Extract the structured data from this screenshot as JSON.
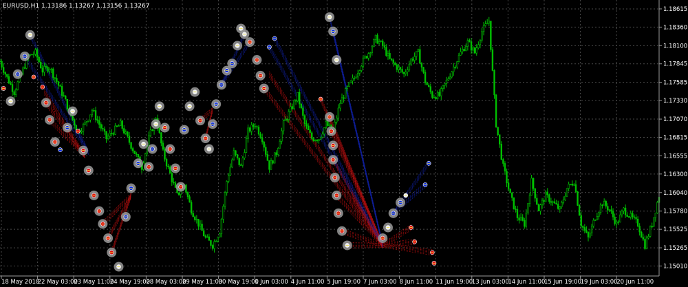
{
  "chart_data": {
    "type": "candlestick",
    "title": "EURUSD,H1  1.13186 1.13267 1.13156 1.13267",
    "grid": true,
    "background": "#000000",
    "colors": {
      "bull": "#00c000",
      "bear": "#00c000",
      "grid": "#4a4a4a",
      "axis": "#9a9a9a",
      "text": "#ffffff",
      "marker_ring": "#9a9a9a",
      "marker_white": "#f0f0f0",
      "marker_red": "#e01010",
      "marker_blue": "#1030e0",
      "marker_yellow": "#f0e040",
      "link_red": "#c01010",
      "link_blue": "#1020a0"
    },
    "ylim": [
      1.1487,
      1.1874
    ],
    "y_ticks": [
      "1.18615",
      "1.18360",
      "1.18100",
      "1.17845",
      "1.17585",
      "1.17330",
      "1.17070",
      "1.16815",
      "1.16555",
      "1.16300",
      "1.16040",
      "1.15780",
      "1.15525",
      "1.15265",
      "1.15010"
    ],
    "x_ticks": [
      "18 May 2018",
      "22 May 03:00",
      "23 May 11:00",
      "24 May 19:00",
      "28 May 03:00",
      "29 May 11:00",
      "30 May 19:00",
      "1 Jun 03:00",
      "4 Jun 11:00",
      "5 Jun 19:00",
      "7 Jun 03:00",
      "8 Jun 11:00",
      "11 Jun 19:00",
      "13 Jun 03:00",
      "14 Jun 11:00",
      "15 Jun 19:00",
      "19 Jun 03:00",
      "20 Jun 11:00"
    ],
    "path": [
      [
        0,
        1.1788
      ],
      [
        4,
        1.1765
      ],
      [
        8,
        1.1745
      ],
      [
        12,
        1.177
      ],
      [
        16,
        1.1795
      ],
      [
        20,
        1.18
      ],
      [
        24,
        1.1775
      ],
      [
        28,
        1.178
      ],
      [
        32,
        1.176
      ],
      [
        36,
        1.1738
      ],
      [
        40,
        1.1712
      ],
      [
        44,
        1.169
      ],
      [
        48,
        1.17
      ],
      [
        52,
        1.172
      ],
      [
        56,
        1.17
      ],
      [
        60,
        1.168
      ],
      [
        64,
        1.169
      ],
      [
        68,
        1.17
      ],
      [
        72,
        1.168
      ],
      [
        76,
        1.166
      ],
      [
        80,
        1.164
      ],
      [
        84,
        1.168
      ],
      [
        88,
        1.171
      ],
      [
        92,
        1.166
      ],
      [
        96,
        1.163
      ],
      [
        100,
        1.16
      ],
      [
        104,
        1.1615
      ],
      [
        108,
        1.158
      ],
      [
        112,
        1.156
      ],
      [
        116,
        1.154
      ],
      [
        120,
        1.153
      ],
      [
        124,
        1.155
      ],
      [
        128,
        1.162
      ],
      [
        132,
        1.166
      ],
      [
        136,
        1.164
      ],
      [
        140,
        1.169
      ],
      [
        144,
        1.17
      ],
      [
        148,
        1.168
      ],
      [
        152,
        1.164
      ],
      [
        156,
        1.166
      ],
      [
        160,
        1.17
      ],
      [
        164,
        1.172
      ],
      [
        168,
        1.174
      ],
      [
        172,
        1.17
      ],
      [
        176,
        1.168
      ],
      [
        180,
        1.168
      ],
      [
        184,
        1.17
      ],
      [
        188,
        1.169
      ],
      [
        192,
        1.173
      ],
      [
        196,
        1.175
      ],
      [
        200,
        1.1765
      ],
      [
        204,
        1.1785
      ],
      [
        208,
        1.18
      ],
      [
        212,
        1.182
      ],
      [
        216,
        1.181
      ],
      [
        220,
        1.179
      ],
      [
        224,
        1.178
      ],
      [
        228,
        1.177
      ],
      [
        232,
        1.179
      ],
      [
        236,
        1.18
      ],
      [
        240,
        1.176
      ],
      [
        244,
        1.174
      ],
      [
        248,
        1.174
      ],
      [
        252,
        1.176
      ],
      [
        256,
        1.178
      ],
      [
        260,
        1.18
      ],
      [
        264,
        1.1815
      ],
      [
        268,
        1.18
      ],
      [
        272,
        1.183
      ],
      [
        276,
        1.1845
      ],
      [
        280,
        1.17
      ],
      [
        284,
        1.164
      ],
      [
        288,
        1.16
      ],
      [
        292,
        1.157
      ],
      [
        296,
        1.156
      ],
      [
        300,
        1.162
      ],
      [
        304,
        1.158
      ],
      [
        308,
        1.16
      ],
      [
        312,
        1.159
      ],
      [
        316,
        1.158
      ],
      [
        320,
        1.161
      ],
      [
        324,
        1.162
      ],
      [
        328,
        1.156
      ],
      [
        332,
        1.154
      ],
      [
        336,
        1.157
      ],
      [
        340,
        1.159
      ],
      [
        344,
        1.158
      ],
      [
        348,
        1.156
      ],
      [
        352,
        1.158
      ],
      [
        356,
        1.157
      ],
      [
        360,
        1.156
      ],
      [
        364,
        1.153
      ],
      [
        368,
        1.156
      ],
      [
        372,
        1.16
      ]
    ],
    "zigzag_nodes": [
      [
        2,
        1.175,
        "r",
        0
      ],
      [
        6,
        1.1732,
        "w",
        1
      ],
      [
        10,
        1.177,
        "b",
        1
      ],
      [
        14,
        1.1795,
        "b",
        1
      ],
      [
        17,
        1.1825,
        "w",
        1
      ],
      [
        19,
        1.1766,
        "r",
        0
      ],
      [
        24,
        1.1752,
        "r",
        0
      ],
      [
        26,
        1.173,
        "r",
        1
      ],
      [
        28,
        1.1706,
        "r",
        1
      ],
      [
        31,
        1.1675,
        "r",
        1
      ],
      [
        34,
        1.1664,
        "b",
        0
      ],
      [
        38,
        1.1695,
        "b",
        1
      ],
      [
        41,
        1.1718,
        "w",
        1
      ],
      [
        44,
        1.169,
        "r",
        0
      ],
      [
        47,
        1.1663,
        "r",
        1
      ],
      [
        50,
        1.1635,
        "r",
        1
      ],
      [
        53,
        1.16,
        "r",
        1
      ],
      [
        56,
        1.1578,
        "r",
        1
      ],
      [
        58,
        1.156,
        "r",
        1
      ],
      [
        61,
        1.154,
        "r",
        1
      ],
      [
        63,
        1.152,
        "r",
        1
      ],
      [
        67,
        1.15,
        "w",
        1
      ],
      [
        71,
        1.157,
        "b",
        1
      ],
      [
        74,
        1.161,
        "b",
        1
      ],
      [
        78,
        1.1645,
        "b",
        1
      ],
      [
        81,
        1.1672,
        "w",
        1
      ],
      [
        84,
        1.164,
        "r",
        1
      ],
      [
        86,
        1.1665,
        "b",
        1
      ],
      [
        88,
        1.17,
        "w",
        1
      ],
      [
        90,
        1.1725,
        "w",
        1
      ],
      [
        93,
        1.1695,
        "r",
        1
      ],
      [
        96,
        1.1665,
        "r",
        1
      ],
      [
        99,
        1.1638,
        "r",
        1
      ],
      [
        102,
        1.1612,
        "r",
        1
      ],
      [
        104,
        1.1692,
        "b",
        1
      ],
      [
        107,
        1.1725,
        "w",
        1
      ],
      [
        110,
        1.1745,
        "w",
        1
      ],
      [
        113,
        1.1705,
        "r",
        1
      ],
      [
        116,
        1.168,
        "r",
        1
      ],
      [
        118,
        1.1665,
        "w",
        1
      ],
      [
        120,
        1.17,
        "b",
        1
      ],
      [
        122,
        1.1728,
        "b",
        1
      ],
      [
        125,
        1.1755,
        "b",
        1
      ],
      [
        128,
        1.1775,
        "b",
        1
      ],
      [
        131,
        1.1785,
        "b",
        1
      ],
      [
        134,
        1.181,
        "w",
        1
      ],
      [
        136,
        1.1834,
        "w",
        1
      ],
      [
        138,
        1.1826,
        "w",
        1
      ],
      [
        141,
        1.1815,
        "r",
        1
      ],
      [
        145,
        1.179,
        "r",
        1
      ],
      [
        147,
        1.1768,
        "r",
        1
      ],
      [
        149,
        1.175,
        "r",
        1
      ],
      [
        152,
        1.1808,
        "b",
        0
      ],
      [
        155,
        1.182,
        "b",
        0
      ],
      [
        181,
        1.1735,
        "r",
        0
      ],
      [
        186,
        1.185,
        "w",
        1
      ],
      [
        188,
        1.183,
        "b",
        1
      ],
      [
        190,
        1.179,
        "w",
        1
      ],
      [
        186,
        1.171,
        "r",
        1
      ],
      [
        187,
        1.169,
        "r",
        1
      ],
      [
        188,
        1.167,
        "r",
        1
      ],
      [
        188,
        1.165,
        "r",
        1
      ],
      [
        189,
        1.1625,
        "r",
        1
      ],
      [
        190,
        1.16,
        "r",
        1
      ],
      [
        191,
        1.1575,
        "r",
        1
      ],
      [
        193,
        1.155,
        "r",
        1
      ],
      [
        196,
        1.153,
        "w",
        1
      ],
      [
        216,
        1.154,
        "r",
        1
      ],
      [
        219,
        1.1555,
        "w",
        1
      ],
      [
        222,
        1.1575,
        "b",
        1
      ],
      [
        226,
        1.159,
        "b",
        1
      ],
      [
        229,
        1.16,
        "w",
        0
      ],
      [
        232,
        1.1555,
        "r",
        0
      ],
      [
        234,
        1.1535,
        "r",
        0
      ],
      [
        240,
        1.1615,
        "b",
        0
      ],
      [
        242,
        1.1645,
        "b",
        0
      ],
      [
        244,
        1.152,
        "r",
        0
      ],
      [
        245,
        1.1505,
        "r",
        0
      ]
    ],
    "link_groups": [
      {
        "color": "red",
        "from": [
          [
            25,
            1.1745
          ],
          [
            26,
            1.173
          ],
          [
            28,
            1.1706
          ]
        ],
        "to": [
          48,
          1.1655
        ]
      },
      {
        "color": "blue",
        "from": [
          [
            17,
            1.1825
          ],
          [
            14,
            1.1795
          ]
        ],
        "to": [
          50,
          1.166
        ]
      },
      {
        "color": "red",
        "from": [
          [
            58,
            1.156
          ],
          [
            61,
            1.154
          ],
          [
            63,
            1.152
          ]
        ],
        "to": [
          74,
          1.16
        ]
      },
      {
        "color": "red",
        "from": [
          [
            113,
            1.1705
          ],
          [
            116,
            1.168
          ]
        ],
        "to": [
          120,
          1.172
        ]
      },
      {
        "color": "blue",
        "from": [
          [
            138,
            1.1826
          ],
          [
            141,
            1.1815
          ]
        ],
        "to": [
          125,
          1.1755
        ]
      },
      {
        "color": "red",
        "from": [
          [
            149,
            1.175
          ],
          [
            152,
            1.177
          ],
          [
            181,
            1.1735
          ],
          [
            186,
            1.171
          ],
          [
            187,
            1.169
          ],
          [
            188,
            1.165
          ],
          [
            190,
            1.16
          ]
        ],
        "to": [
          216,
          1.153
        ]
      },
      {
        "color": "blue",
        "from": [
          [
            186,
            1.185
          ],
          [
            188,
            1.183
          ],
          [
            152,
            1.1808
          ],
          [
            155,
            1.182
          ]
        ],
        "to": [
          216,
          1.153
        ]
      },
      {
        "color": "red",
        "from": [
          [
            193,
            1.155
          ],
          [
            196,
            1.153
          ],
          [
            199,
            1.16
          ]
        ],
        "to": [
          216,
          1.153
        ]
      },
      {
        "color": "red",
        "from": [
          [
            232,
            1.1555
          ],
          [
            234,
            1.1535
          ],
          [
            244,
            1.152
          ]
        ],
        "to": [
          216,
          1.153
        ]
      },
      {
        "color": "blue",
        "from": [
          [
            240,
            1.1615
          ],
          [
            242,
            1.1645
          ]
        ],
        "to": [
          222,
          1.1575
        ]
      }
    ]
  }
}
